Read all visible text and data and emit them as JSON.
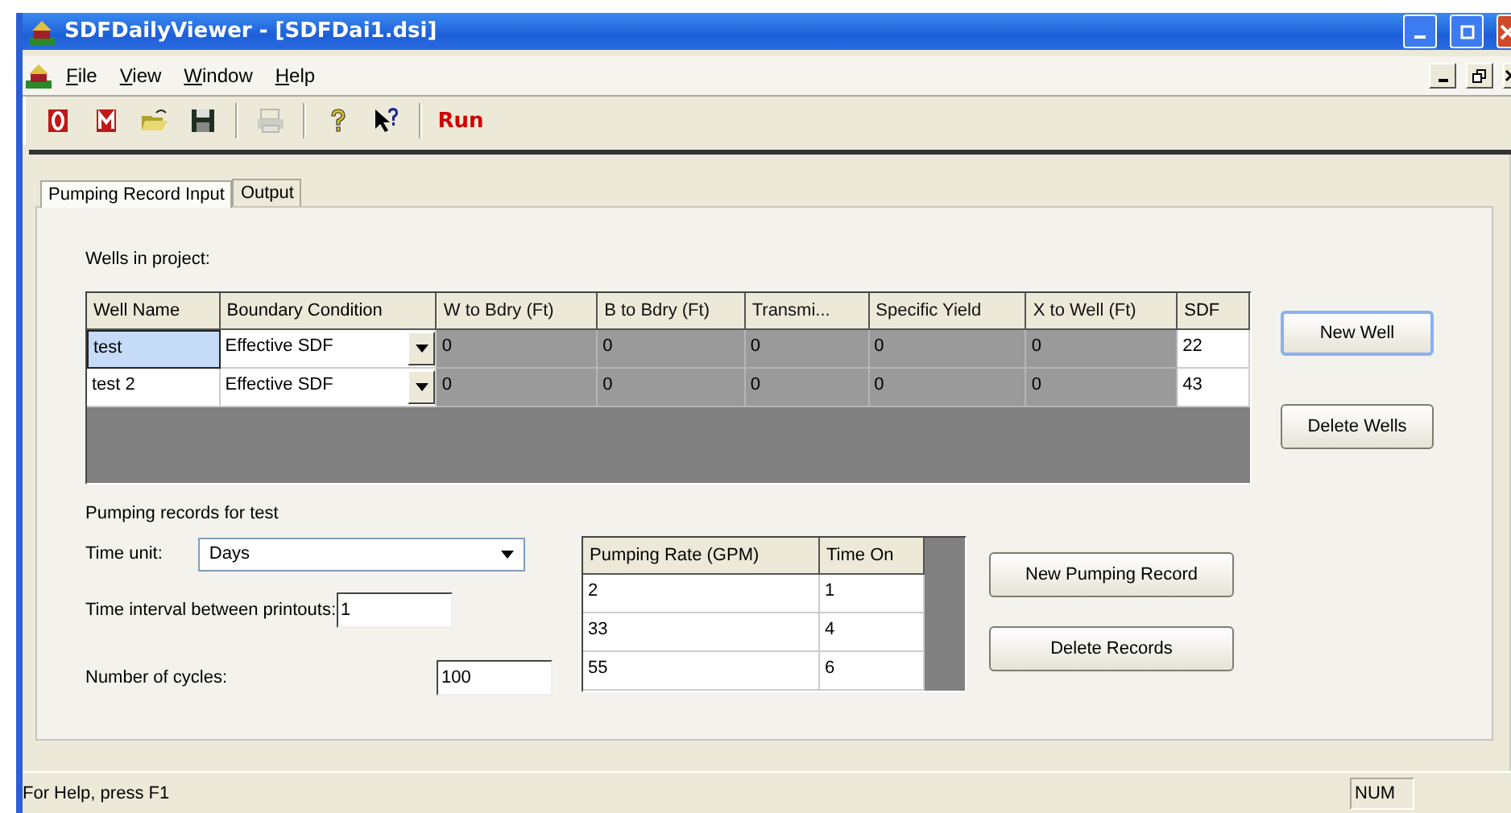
{
  "window": {
    "title": "SDFDailyViewer - [SDFDai1.dsi]"
  },
  "menu": [
    "File",
    "View",
    "Window",
    "Help"
  ],
  "toolbar": [
    {
      "kind": "icon",
      "disabled": false
    },
    {
      "kind": "icon",
      "disabled": false
    },
    {
      "kind": "icon",
      "disabled": false
    },
    {
      "kind": "icon",
      "disabled": false
    },
    {
      "kind": "separator"
    },
    {
      "kind": "icon",
      "disabled": true
    },
    {
      "kind": "separator"
    },
    {
      "kind": "icon",
      "disabled": false
    },
    {
      "kind": "icon",
      "disabled": false
    },
    {
      "kind": "separator"
    },
    {
      "kind": "text",
      "label": "Run",
      "disabled": false
    }
  ],
  "tabs": [
    {
      "label": "Pumping Record Input",
      "selected": true
    },
    {
      "label": "Output",
      "selected": false
    }
  ],
  "wells": {
    "label": "Wells in project:",
    "columns": [
      {
        "label": "Well Name",
        "kind": "text",
        "disabled": false
      },
      {
        "label": "Boundary Condition",
        "kind": "dropdown",
        "disabled": false
      },
      {
        "label": "W to Bdry (Ft)",
        "kind": "text",
        "disabled": true
      },
      {
        "label": "B to Bdry (Ft)",
        "kind": "text",
        "disabled": true
      },
      {
        "label": "Transmi...",
        "kind": "text",
        "disabled": true
      },
      {
        "label": "Specific Yield",
        "kind": "text",
        "disabled": true
      },
      {
        "label": "X to Well (Ft)",
        "kind": "text",
        "disabled": true
      },
      {
        "label": "SDF",
        "kind": "text",
        "disabled": false
      }
    ],
    "rows": [
      {
        "selected": true,
        "cells": [
          "test",
          "Effective SDF",
          "0",
          "0",
          "0",
          "0",
          "0",
          "22"
        ]
      },
      {
        "selected": false,
        "cells": [
          "test 2",
          "Effective SDF",
          "0",
          "0",
          "0",
          "0",
          "0",
          "43"
        ]
      }
    ],
    "buttons": [
      {
        "label": "New Well",
        "focused": true
      },
      {
        "label": "Delete Wells",
        "focused": false
      }
    ]
  },
  "records": {
    "label": "Pumping records for test",
    "time_unit": {
      "label": "Time unit:",
      "value": "Days"
    },
    "interval": {
      "label": "Time interval between printouts:",
      "value": "1"
    },
    "cycles": {
      "label": "Number of cycles:",
      "value": "100"
    },
    "columns": [
      "Pumping Rate (GPM)",
      "Time On"
    ],
    "rows": [
      [
        "2",
        "1"
      ],
      [
        "33",
        "4"
      ],
      [
        "55",
        "6"
      ]
    ],
    "buttons": [
      {
        "label": "New Pumping Record",
        "focused": false
      },
      {
        "label": "Delete Records",
        "focused": false
      }
    ]
  },
  "status_bar": {
    "text": "For Help, press F1",
    "indicators": [
      "NUM"
    ]
  }
}
